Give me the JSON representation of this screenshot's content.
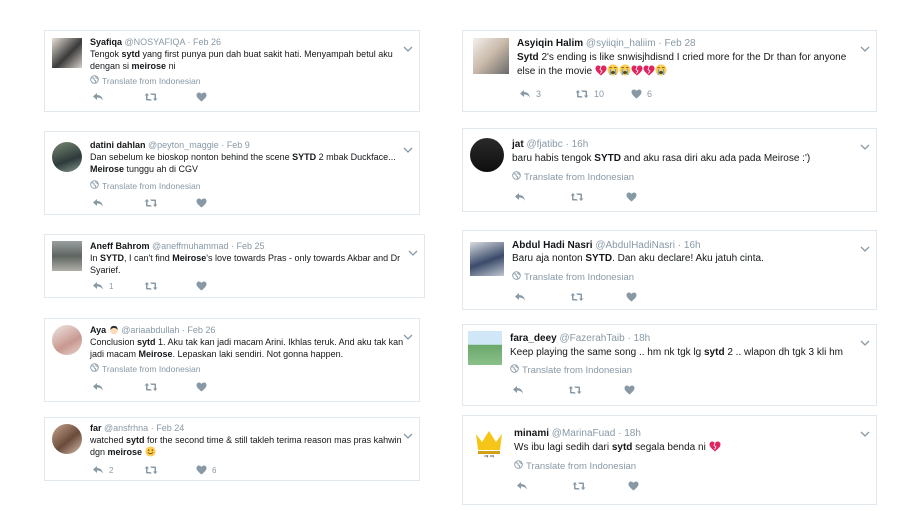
{
  "translate_label": "Translate from Indonesian",
  "tweets": [
    {
      "name": "Syafiqa",
      "handle": "@NOSYAFIQA",
      "date": "Feb 26",
      "lines": [
        [
          "Tengok ",
          {
            "b": "sytd"
          },
          " yang first punya pun dah buat sakit hati. Menyampah betul aku"
        ],
        [
          "dengan si ",
          {
            "b": "meirose"
          },
          " ni"
        ]
      ],
      "reply": "",
      "retweet": "",
      "like": ""
    },
    {
      "name": "datini dahlan",
      "handle": "@peyton_maggie",
      "date": "Feb 9",
      "lines": [
        [
          "Dan sebelum ke bioskop nonton behind the scene ",
          {
            "b": "SYTD"
          },
          " 2 mbak Duckface..."
        ],
        [
          {
            "b": "Meirose"
          },
          " tunggu ah di CGV"
        ]
      ],
      "reply": "",
      "retweet": "",
      "like": ""
    },
    {
      "name": "Aneff Bahrom",
      "handle": "@aneffmuhammad",
      "date": "Feb 25",
      "lines": [
        [
          "In ",
          {
            "b": "SYTD"
          },
          ", I can't find ",
          {
            "b": "Meirose"
          },
          "'s love towards Pras - only towards Akbar and Dr"
        ],
        [
          "Syarief."
        ]
      ],
      "reply": "1",
      "retweet": "",
      "like": ""
    },
    {
      "name": "Aya",
      "handle": "@ariaabdullah",
      "date": "Feb 26",
      "lines": [
        [
          "Conclusion ",
          {
            "b": "sytd"
          },
          " 1. Aku tak kan jadi macam Arini. Ikhlas teruk. And aku tak kan"
        ],
        [
          "jadi macam ",
          {
            "b": "Meirose"
          },
          ". Lepaskan laki sendiri. Not gonna happen."
        ]
      ],
      "reply": "",
      "retweet": "",
      "like": ""
    },
    {
      "name": "far",
      "handle": "@ansfrhna",
      "date": "Feb 24",
      "lines": [
        [
          "watched ",
          {
            "b": "sytd"
          },
          " for the second time & still takleh terima reason mas pras kahwin"
        ],
        [
          "dgn ",
          {
            "b": "meirose"
          },
          " "
        ]
      ],
      "reply": "2",
      "retweet": "",
      "like": "6"
    },
    {
      "name": "Asyiqin Halim",
      "handle": "@syiiqin_haliim",
      "date": "Feb 28",
      "lines": [
        [
          {
            "b": "Sytd"
          },
          " 2's ending is like snwisjhdisnd I cried more for the Dr than for anyone"
        ],
        [
          "else in the movie "
        ]
      ],
      "reply": "3",
      "retweet": "10",
      "like": "6"
    },
    {
      "name": "jat",
      "handle": "@fjatibc",
      "date": "16h",
      "lines": [
        [
          "baru habis tengok ",
          {
            "b": "SYTD"
          },
          " and aku rasa diri aku ada pada Meirose :')"
        ]
      ],
      "reply": "",
      "retweet": "",
      "like": ""
    },
    {
      "name": "Abdul Hadi Nasri",
      "handle": "@AbdulHadiNasri",
      "date": "16h",
      "lines": [
        [
          "Baru aja nonton ",
          {
            "b": "SYTD"
          },
          ". Dan aku declare! Aku jatuh cinta."
        ]
      ],
      "reply": "",
      "retweet": "",
      "like": ""
    },
    {
      "name": "fara_deey",
      "handle": "@FazerahTaib",
      "date": "18h",
      "lines": [
        [
          "Keep playing the same song .. hm nk tgk lg ",
          {
            "b": "sytd"
          },
          " 2 .. wlapon dh tgk 3 kli hm"
        ]
      ],
      "reply": "",
      "retweet": "",
      "like": ""
    },
    {
      "name": "minami",
      "handle": "@MarinaFuad",
      "date": "18h",
      "lines": [
        [
          "Ws ibu lagi sedih dari ",
          {
            "b": "sytd"
          },
          " segala benda ni "
        ]
      ],
      "reply": "",
      "retweet": "",
      "like": ""
    }
  ],
  "colors": {
    "broken_heart": "#e0245e",
    "crying_face": "#ffcc4d",
    "icon_gray": "#8899a6"
  }
}
